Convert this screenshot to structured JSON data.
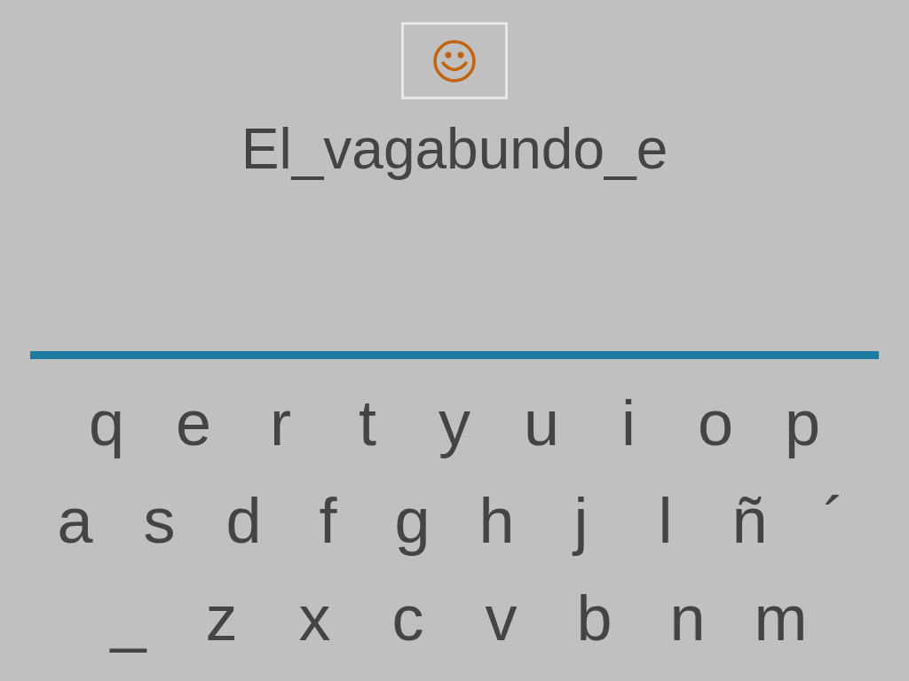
{
  "phrase": "El_vagabundo_e",
  "keyboard": [
    [
      "q",
      "e",
      "r",
      "t",
      "y",
      "u",
      "i",
      "o",
      "p"
    ],
    [
      "a",
      "s",
      "d",
      "f",
      "g",
      "h",
      "j",
      "l",
      "ñ",
      "´"
    ],
    [
      "_",
      "z",
      "x",
      "c",
      "v",
      "b",
      "n",
      "m"
    ]
  ]
}
